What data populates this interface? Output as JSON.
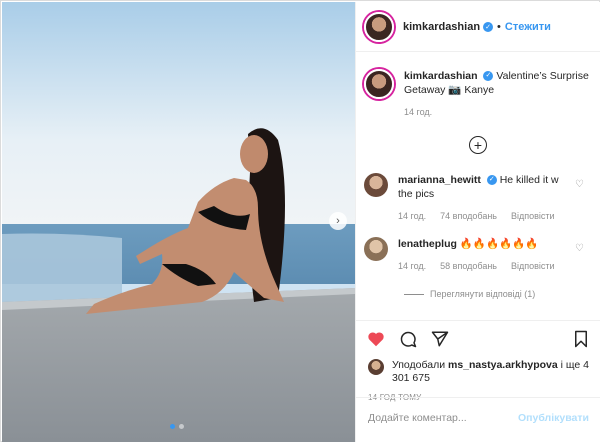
{
  "header": {
    "username": "kimkardashian",
    "follow_label": "Стежити",
    "bullet": "•"
  },
  "caption": {
    "username": "kimkardashian",
    "text": "Valentine’s Surprise Getaway 📷 Kanye",
    "time": "14 год."
  },
  "comments": [
    {
      "username": "marianna_hewitt",
      "text": "He killed it w the pics",
      "time": "14 год.",
      "likes": "74 вподобань",
      "reply": "Відповісти"
    },
    {
      "username": "lenatheplug",
      "text": "🔥🔥🔥🔥🔥🔥",
      "time": "14 год.",
      "likes": "58 вподобань",
      "reply": "Відповісти"
    }
  ],
  "view_replies": "Переглянути відповіді (1)",
  "likes": {
    "prefix": "Уподобали",
    "user": "ms_nastya.arkhypova",
    "suffix": "і ще 4 301 675"
  },
  "timestamp": "14 ГОД ТОМУ",
  "comment_input": {
    "placeholder": "Додайте коментар...",
    "publish": "Опублікувати"
  },
  "colors": {
    "accent": "#3897f0",
    "like_red": "#ed4956",
    "publish_disabled": "#b2dffc"
  }
}
